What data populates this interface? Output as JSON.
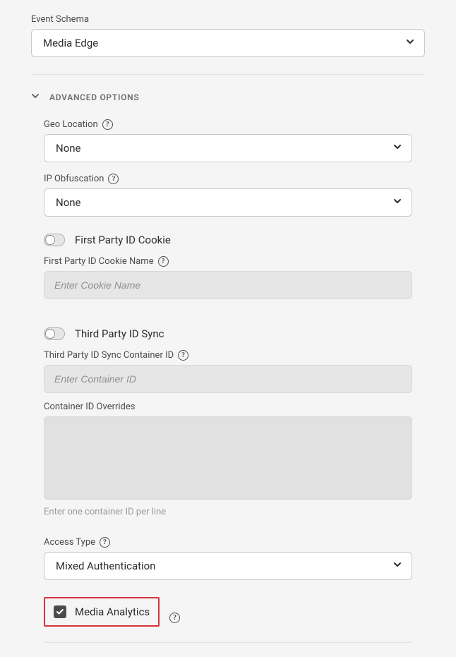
{
  "eventSchema": {
    "label": "Event Schema",
    "value": "Media Edge"
  },
  "advanced": {
    "header": "ADVANCED OPTIONS",
    "geo": {
      "label": "Geo Location",
      "value": "None"
    },
    "ip": {
      "label": "IP Obfuscation",
      "value": "None"
    },
    "firstParty": {
      "toggleLabel": "First Party ID Cookie",
      "cookieNameLabel": "First Party ID Cookie Name",
      "cookiePlaceholder": "Enter Cookie Name"
    },
    "thirdParty": {
      "toggleLabel": "Third Party ID Sync",
      "containerIdLabel": "Third Party ID Sync Container ID",
      "containerIdPlaceholder": "Enter Container ID",
      "overridesLabel": "Container ID Overrides",
      "overridesHint": "Enter one container ID per line"
    },
    "access": {
      "label": "Access Type",
      "value": "Mixed Authentication"
    },
    "media": {
      "label": "Media Analytics",
      "checked": true
    }
  }
}
